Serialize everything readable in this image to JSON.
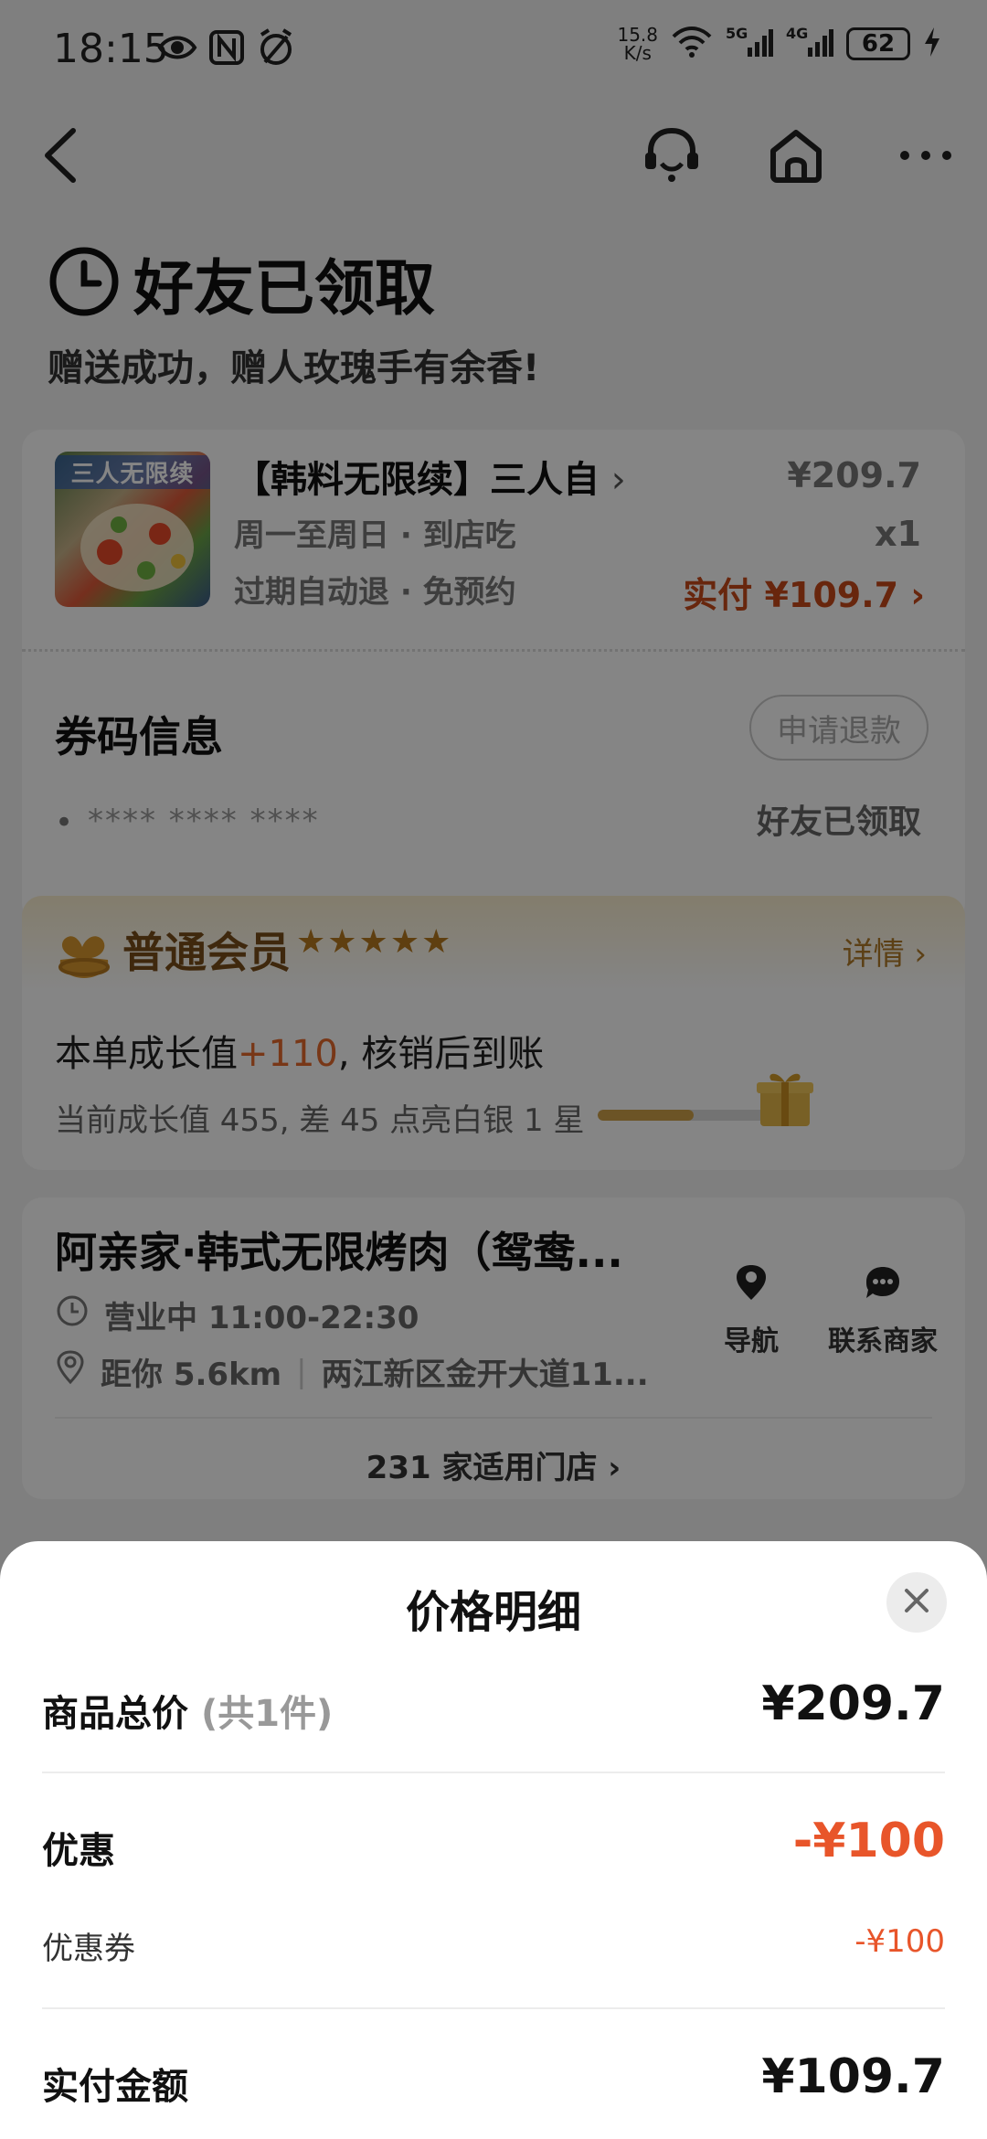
{
  "status_bar": {
    "time": "18:15",
    "speed_value": "15.8",
    "speed_unit": "K/s",
    "battery": "62",
    "icons": [
      "eye-icon",
      "nfc-icon",
      "alarm-icon",
      "wifi-icon",
      "signal-5g-icon",
      "signal-4g-icon",
      "battery-icon",
      "charging-icon"
    ]
  },
  "nav": {
    "icons": [
      "back-icon",
      "customer-service-icon",
      "home-icon",
      "more-icon"
    ]
  },
  "order_status": {
    "title": "好友已领取",
    "subtitle": "赠送成功，赠人玫瑰手有余香!"
  },
  "product": {
    "thumb_label": "三人无限续",
    "name": "【韩料无限续】三人自",
    "line1": "周一至周日 · 到店吃",
    "line2": "过期自动退 · 免预约",
    "price": "¥209.7",
    "qty": "x1",
    "paid_label": "实付",
    "paid_amount": "¥109.7"
  },
  "coupon": {
    "title": "券码信息",
    "refund_button": "申请退款",
    "bullet": "•",
    "code_masked": "**** **** ****",
    "status": "好友已领取"
  },
  "member": {
    "level": "普通会员",
    "stars": "★★★★★",
    "detail": "详情",
    "growth_prefix": "本单成长值",
    "growth_value": "+110",
    "growth_suffix": ", 核销后到账",
    "current_text": "当前成长值 455, 差 45 点亮白银 1 星",
    "progress_fraction": 0.55,
    "colors": {
      "accent": "#b07b2a",
      "plus": "#e76a2c"
    }
  },
  "store": {
    "name": "阿亲家·韩式无限烤肉（鸳鸯...",
    "hours": "营业中 11:00-22:30",
    "distance": "距你 5.6km",
    "address": "两江新区金开大道11...",
    "nav_label": "导航",
    "contact_label": "联系商家",
    "stores_link": "231 家适用门店"
  },
  "price_sheet": {
    "title": "价格明细",
    "total_label": "商品总价",
    "total_count": "(共1件)",
    "total_value": "¥209.7",
    "discount_label": "优惠",
    "discount_value": "-¥100",
    "coupon_label": "优惠券",
    "coupon_value": "-¥100",
    "paid_label": "实付金额",
    "paid_value": "¥109.7",
    "colors": {
      "discount": "#e8552a"
    }
  }
}
